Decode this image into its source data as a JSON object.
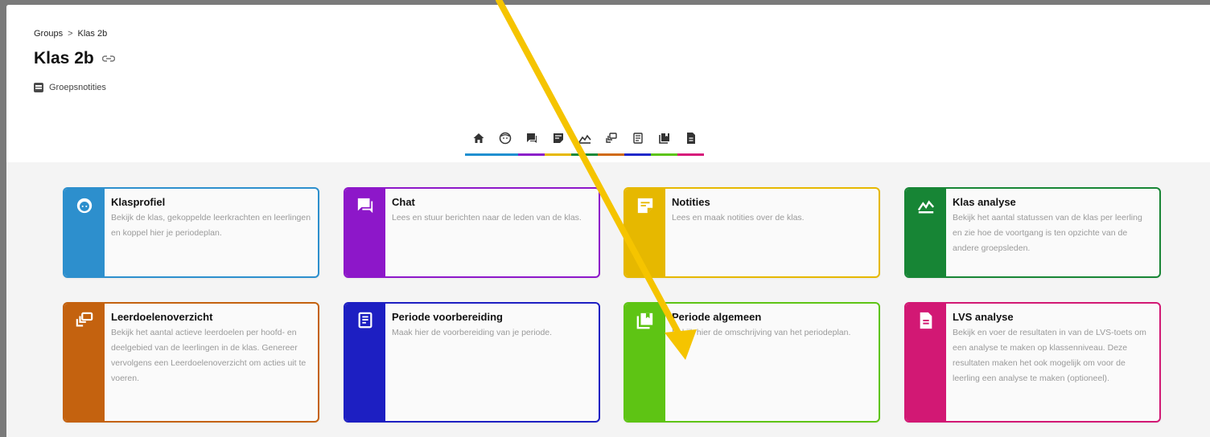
{
  "breadcrumb": {
    "root": "Groups",
    "separator": ">",
    "current": "Klas 2b"
  },
  "page": {
    "title": "Klas 2b",
    "link_icon": "link-icon"
  },
  "group_notes": {
    "label": "Groepsnotities",
    "icon": "notes-icon"
  },
  "tabs": [
    {
      "icon": "home-icon",
      "color": "#1f8fd0",
      "active": true
    },
    {
      "icon": "face-icon",
      "color": "#1f8fd0"
    },
    {
      "icon": "chat-icon",
      "color": "#8b1fc9"
    },
    {
      "icon": "note-icon",
      "color": "#e6b800"
    },
    {
      "icon": "analysis-icon",
      "color": "#1a8a3a"
    },
    {
      "icon": "goals-icon",
      "color": "#d06a12"
    },
    {
      "icon": "preparation-icon",
      "color": "#1f28c9"
    },
    {
      "icon": "book-icon",
      "color": "#5cc414"
    },
    {
      "icon": "document-icon",
      "color": "#d6187a"
    }
  ],
  "cards": [
    {
      "title": "Klasprofiel",
      "description": "Bekijk de klas, gekoppelde leerkrachten en leerlingen en koppel hier je periodeplan.",
      "color": "#2d8fcd",
      "icon": "face-icon"
    },
    {
      "title": "Chat",
      "description": "Lees en stuur berichten naar de leden van de klas.",
      "color": "#8d17c9",
      "icon": "chat-icon"
    },
    {
      "title": "Notities",
      "description": "Lees en maak notities over de klas.",
      "color": "#e6b800",
      "icon": "note-icon"
    },
    {
      "title": "Klas analyse",
      "description": "Bekijk het aantal statussen van de klas per leerling en zie hoe de voortgang is ten opzichte van de andere groepsleden.",
      "color": "#178535",
      "icon": "analysis-icon"
    },
    {
      "title": "Leerdoelenoverzicht",
      "description": "Bekijk het aantal actieve leerdoelen per hoofd- en deelgebied van de leerlingen in de klas. Genereer vervolgens een Leerdoelenoverzicht om acties uit te voeren.",
      "color": "#c4620f",
      "icon": "goals-icon"
    },
    {
      "title": "Periode voorbereiding",
      "description": "Maak hier de voorbereiding van je periode.",
      "color": "#1d1fc2",
      "icon": "preparation-icon"
    },
    {
      "title": "Periode algemeen",
      "description": "Bekijk hier de omschrijving van het periodeplan.",
      "color": "#5ec414",
      "icon": "book-icon"
    },
    {
      "title": "LVS analyse",
      "description": "Bekijk en voer de resultaten in van de LVS-toets om een analyse te maken op klassenniveau. Deze resultaten maken het ook mogelijk om voor de leerling een analyse te maken (optioneel).",
      "color": "#d21874",
      "icon": "document-icon"
    }
  ],
  "annotation": {
    "arrow_color": "#f5c400"
  }
}
